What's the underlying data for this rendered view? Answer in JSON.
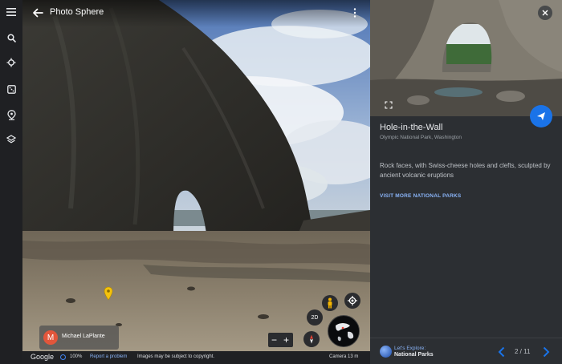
{
  "header": {
    "title": "Photo Sphere"
  },
  "sidebar": {
    "items": [
      {
        "icon": "menu-icon"
      },
      {
        "icon": "search-icon"
      },
      {
        "icon": "voyager-icon"
      },
      {
        "icon": "dice-icon"
      },
      {
        "icon": "projects-icon"
      },
      {
        "icon": "layers-icon"
      }
    ]
  },
  "viewer": {
    "contributor": {
      "initial": "M",
      "name": "Michael LaPlante"
    },
    "controls": {
      "mode_2d": "2D",
      "zoom_out": "−",
      "zoom_in": "+"
    }
  },
  "status": {
    "logo": "Google",
    "zoom_pct": "100%",
    "report": "Report a problem",
    "copyright": "Images may be subject to copyright.",
    "camera": "Camera  13 m"
  },
  "card": {
    "title": "Hole-in-the-Wall",
    "subtitle": "Olympic National Park, Washington",
    "description": "Rock faces, with Swiss-cheese holes and clefts, sculpted by ancient volcanic eruptions",
    "link": "VISIT MORE NATIONAL PARKS",
    "footer": {
      "line1": "Let's Explore:",
      "line2": "National Parks",
      "page": "2 / 11"
    }
  },
  "colors": {
    "accent": "#1a73e8",
    "link": "#8ab4f8",
    "panel": "#2c2f33",
    "pin": "#f4c20d",
    "avatar": "#e2563b"
  }
}
